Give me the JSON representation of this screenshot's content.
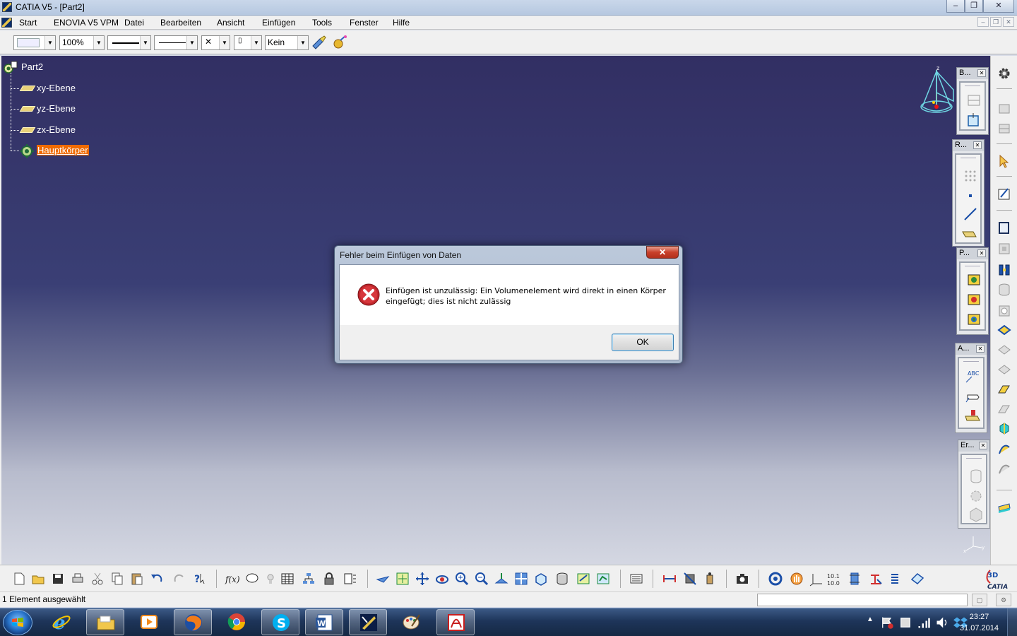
{
  "window": {
    "title": "CATIA V5 - [Part2]",
    "minimize_label": "–",
    "restore_label": "❐",
    "close_label": "✕"
  },
  "menu": {
    "items": [
      {
        "label": "Start"
      },
      {
        "label": "ENOVIA V5 VPM"
      },
      {
        "label": "Datei"
      },
      {
        "label": "Bearbeiten"
      },
      {
        "label": "Ansicht"
      },
      {
        "label": "Einfügen"
      },
      {
        "label": "Tools"
      },
      {
        "label": "Fenster"
      },
      {
        "label": "Hilfe"
      }
    ]
  },
  "properties_toolbar": {
    "transparency": "100%",
    "layer": "Kein"
  },
  "tree": {
    "root": "Part2",
    "nodes": [
      {
        "label": "xy-Ebene",
        "icon": "plane-icon"
      },
      {
        "label": "yz-Ebene",
        "icon": "plane-icon"
      },
      {
        "label": "zx-Ebene",
        "icon": "plane-icon"
      },
      {
        "label": "Hauptkörper",
        "icon": "body-icon",
        "selected": true
      }
    ]
  },
  "floating_toolbars": [
    {
      "title": "B..."
    },
    {
      "title": "R..."
    },
    {
      "title": "P..."
    },
    {
      "title": "A..."
    },
    {
      "title": "Er..."
    }
  ],
  "compass_axis_label": "z",
  "dialog": {
    "title": "Fehler beim Einfügen von Daten",
    "close_label": "✕",
    "message_line1": "Einfügen ist unzulässig: Ein Volumenelement wird direkt in einen Körper",
    "message_line2": "eingefügt; dies ist nicht zulässig",
    "ok_label": "OK",
    "icon": "error-icon"
  },
  "status": {
    "text": "1 Element ausgewählt"
  },
  "taskbar": {
    "time": "23:27",
    "date": "31.07.2014",
    "apps": [
      "explorer",
      "media-player",
      "firefox",
      "chrome",
      "skype",
      "word",
      "catia",
      "paint",
      "acrobat"
    ]
  },
  "colors": {
    "selection": "#ef6a00",
    "viewport_top": "#322f63",
    "viewport_bottom": "#d4d7e2"
  }
}
